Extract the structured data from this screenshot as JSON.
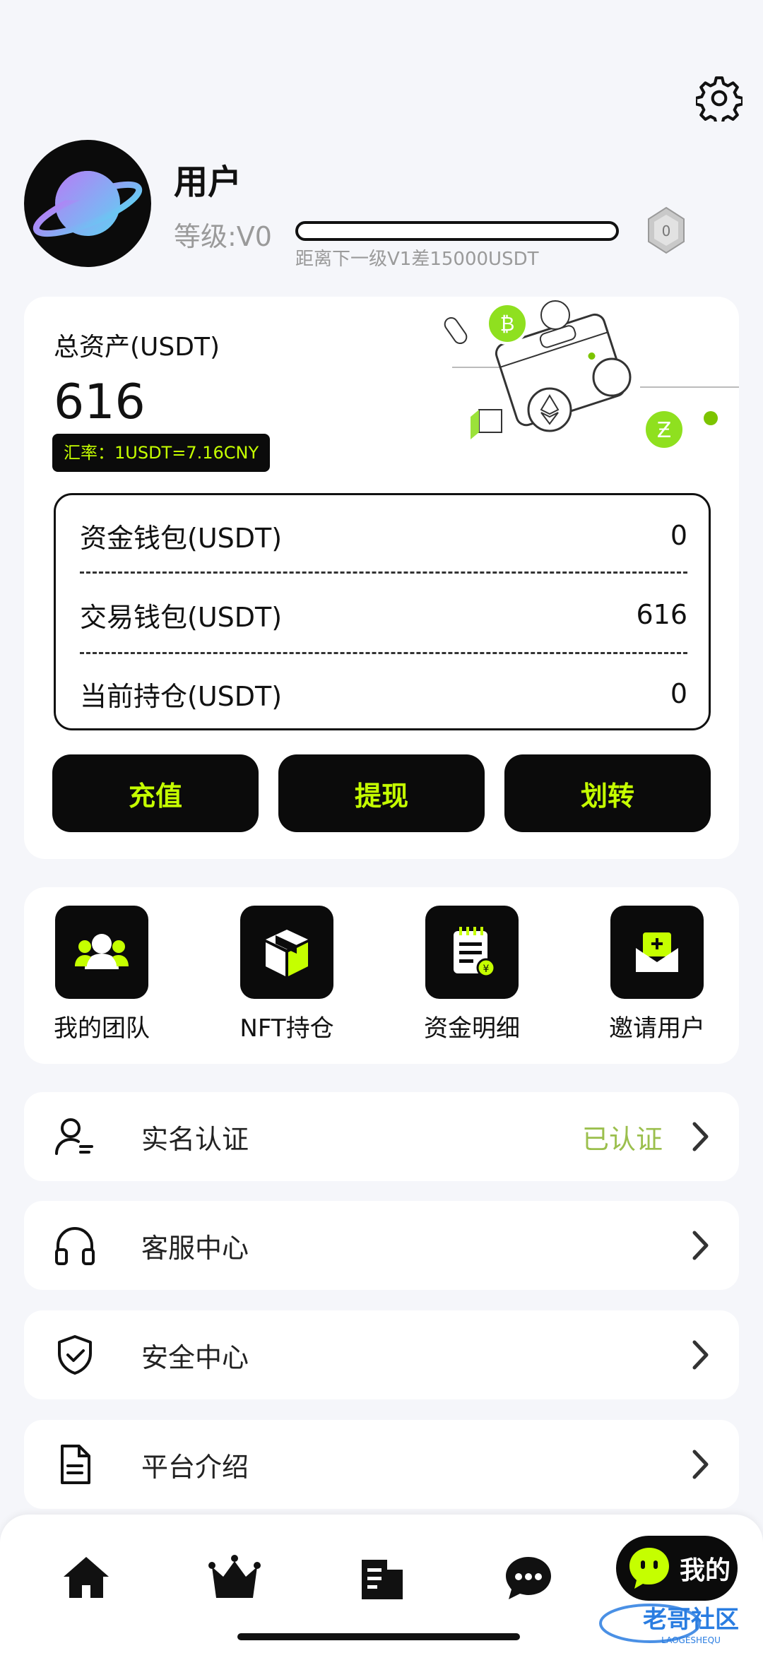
{
  "profile": {
    "username": "用户",
    "level": "等级:V0",
    "level_hint": "距离下一级V1差15000USDT",
    "level_progress": 0,
    "badge_level": "0"
  },
  "assets": {
    "total_label": "总资产(USDT)",
    "total_value": "616",
    "rate": "汇率：1USDT=7.16CNY",
    "wallets": [
      {
        "label": "资金钱包(USDT)",
        "value": "0"
      },
      {
        "label": "交易钱包(USDT)",
        "value": "616"
      },
      {
        "label": "当前持仓(USDT)",
        "value": "0"
      }
    ],
    "actions": [
      "充值",
      "提现",
      "划转"
    ]
  },
  "shortcuts": [
    {
      "label": "我的团队",
      "icon": "team-icon"
    },
    {
      "label": "NFT持仓",
      "icon": "box-icon"
    },
    {
      "label": "资金明细",
      "icon": "ledger-icon"
    },
    {
      "label": "邀请用户",
      "icon": "invite-icon"
    }
  ],
  "menu": [
    {
      "label": "实名认证",
      "status": "已认证",
      "icon": "user-verify-icon"
    },
    {
      "label": "客服中心",
      "status": "",
      "icon": "headset-icon"
    },
    {
      "label": "安全中心",
      "status": "",
      "icon": "shield-icon"
    },
    {
      "label": "平台介绍",
      "status": "",
      "icon": "document-icon"
    }
  ],
  "tabbar": {
    "active_label": "我的",
    "tabs": [
      "home-icon",
      "crown-icon",
      "buildings-icon",
      "chat-icon",
      "mine-icon"
    ]
  },
  "watermark": {
    "main": "老哥社区",
    "sub": "LAOGESHEQU"
  },
  "colors": {
    "accent": "#c5ff00",
    "dark": "#0b0b0b",
    "verified": "#9bbf4d",
    "background": "#f5f6fa"
  }
}
